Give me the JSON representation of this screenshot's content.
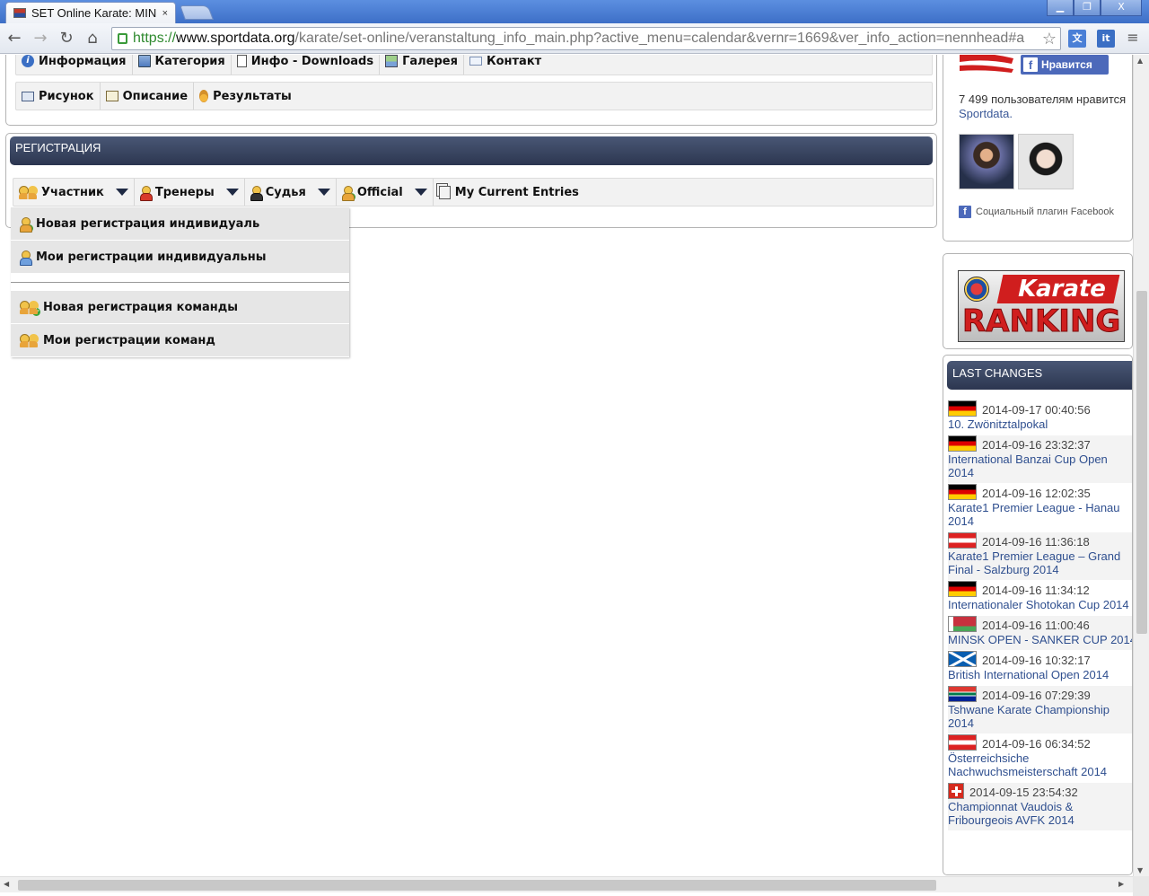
{
  "browser": {
    "tab_title": "SET Online Karate: MIN",
    "tab_close": "×",
    "url_scheme": "https://",
    "url_host": "www.sportdata.org",
    "url_path": "/karate/set-online/veranstaltung_info_main.php?active_menu=calendar&vernr=1669&ver_info_action=nennhead#a",
    "window_buttons": [
      "▁",
      "❐",
      "X"
    ]
  },
  "event_menu": {
    "row1": [
      "Информация",
      "Категория",
      "Инфо - Downloads",
      "Галерея",
      "Контакт"
    ],
    "row2": [
      "Рисунок",
      "Описание",
      "Результаты"
    ]
  },
  "registration": {
    "title": "РЕГИСТРАЦИЯ",
    "menu": [
      "Участник",
      "Тренеры",
      "Судья",
      "Official",
      "My Current Entries"
    ],
    "dropdown": [
      "Новая регистрация индивидуаль",
      "Мои регистрации индивидуальны",
      "Новая регистрация команды",
      "Мои регистрации команд"
    ]
  },
  "facebook": {
    "like_label": "Нравится",
    "count_text": "7 499 пользователям нравится",
    "page_link": "Sportdata.",
    "social_plugin": "Социальный плагин Facebook"
  },
  "banner": {
    "line1": "Karate",
    "line2": "RANKING"
  },
  "last_changes": {
    "title": "LAST CHANGES",
    "items": [
      {
        "flag": "de",
        "date": "2014-09-17 00:40:56",
        "name": "10. Zwönitztalpokal"
      },
      {
        "flag": "de",
        "date": "2014-09-16 23:32:37",
        "name": "International Banzai Cup Open 2014"
      },
      {
        "flag": "de",
        "date": "2014-09-16 12:02:35",
        "name": "Karate1 Premier League - Hanau 2014"
      },
      {
        "flag": "at",
        "date": "2014-09-16 11:36:18",
        "name": "Karate1 Premier League – Grand Final - Salzburg 2014"
      },
      {
        "flag": "de",
        "date": "2014-09-16 11:34:12",
        "name": "Internationaler Shotokan Cup 2014"
      },
      {
        "flag": "by",
        "date": "2014-09-16 11:00:46",
        "name": "MINSK OPEN - SANKER CUP 2014"
      },
      {
        "flag": "sco",
        "date": "2014-09-16 10:32:17",
        "name": "British International Open 2014"
      },
      {
        "flag": "za",
        "date": "2014-09-16 07:29:39",
        "name": "Tshwane Karate Championship 2014"
      },
      {
        "flag": "at",
        "date": "2014-09-16 06:34:52",
        "name": "Österreichsiche Nachwuchsmeisterschaft 2014"
      },
      {
        "flag": "ch",
        "date": "2014-09-15 23:54:32",
        "name": "Championnat Vaudois & Fribourgeois AVFK 2014"
      }
    ]
  }
}
